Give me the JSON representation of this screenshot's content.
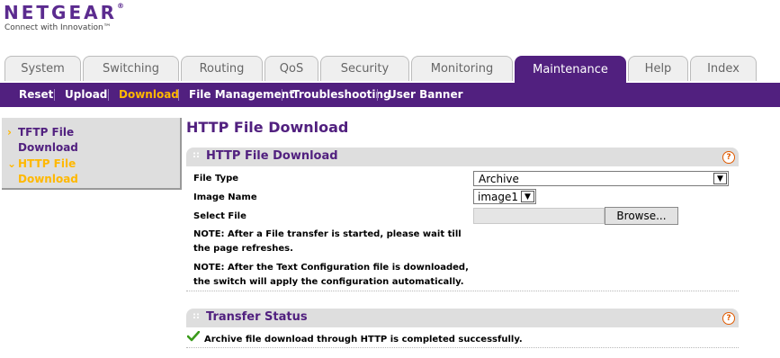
{
  "brand": {
    "logo": "NETGEAR",
    "registered": "®",
    "tagline": "Connect with Innovation™"
  },
  "tabs": [
    {
      "label": "System"
    },
    {
      "label": "Switching"
    },
    {
      "label": "Routing"
    },
    {
      "label": "QoS"
    },
    {
      "label": "Security"
    },
    {
      "label": "Monitoring"
    },
    {
      "label": "Maintenance",
      "active": true
    },
    {
      "label": "Help"
    },
    {
      "label": "Index"
    }
  ],
  "subnav": [
    {
      "label": "Reset"
    },
    {
      "label": "Upload"
    },
    {
      "label": "Download",
      "active": true
    },
    {
      "label": "File Management"
    },
    {
      "label": "Troubleshooting"
    },
    {
      "label": "User Banner"
    }
  ],
  "leftnav": [
    {
      "marker": "›",
      "line1": "TFTP File",
      "line2": "Download"
    },
    {
      "marker": "⌄",
      "line1": "HTTP File",
      "line2": "Download",
      "active": true
    }
  ],
  "page": {
    "title": "HTTP File Download"
  },
  "download_section": {
    "title": "HTTP File Download",
    "dots": "::",
    "help": "?",
    "file_type_label": "File Type",
    "file_type_value": "Archive",
    "image_name_label": "Image Name",
    "image_name_value": "image1",
    "select_file_label": "Select File",
    "browse_label": "Browse...",
    "note1_line1": "NOTE: After a File transfer is started, please wait till",
    "note1_line2": "the page refreshes.",
    "note2_line1": "NOTE: After the Text Configuration file is downloaded,",
    "note2_line2": "the switch will apply the configuration automatically."
  },
  "status_section": {
    "title": "Transfer Status",
    "dots": "::",
    "help": "?",
    "message": "Archive file download through HTTP is completed successfully."
  },
  "colors": {
    "brand_purple": "#51207f",
    "active_orange": "#ffb800",
    "help_orange": "#e05a00",
    "check_green": "#3a9a1a"
  }
}
